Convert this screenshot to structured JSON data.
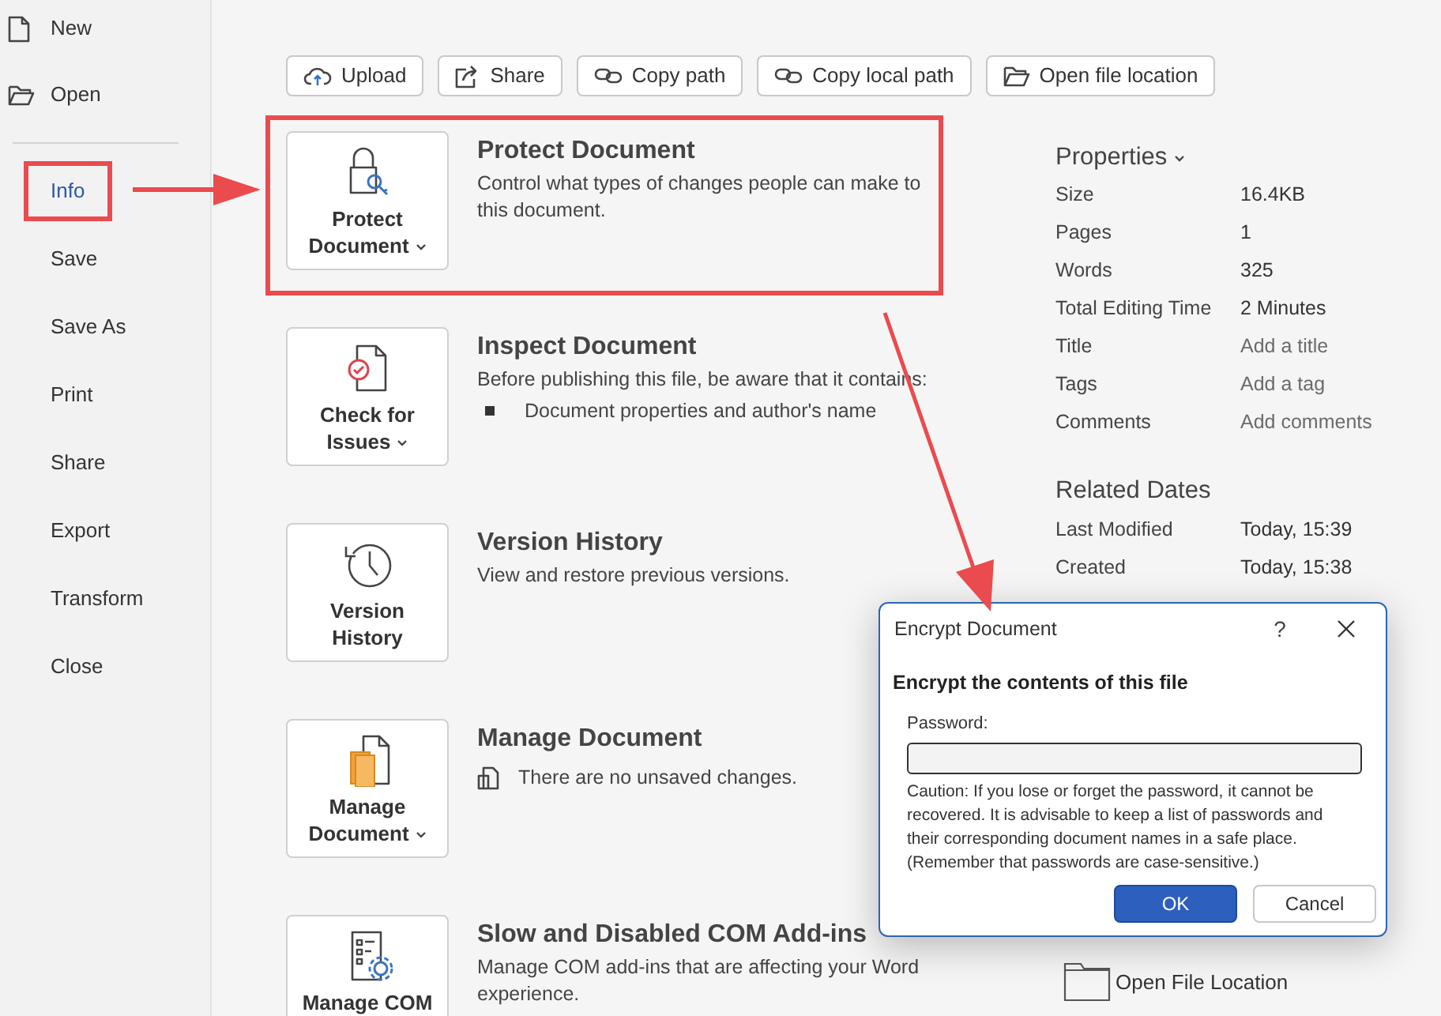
{
  "sidebar": {
    "top_items": [
      {
        "label": "New"
      },
      {
        "label": "Open"
      }
    ],
    "items": [
      {
        "label": "Info",
        "selected": true,
        "highlighted": true
      },
      {
        "label": "Save",
        "selected": false,
        "highlighted": false
      },
      {
        "label": "Save As",
        "selected": false,
        "highlighted": false
      },
      {
        "label": "Print",
        "selected": false,
        "highlighted": false
      },
      {
        "label": "Share",
        "selected": false,
        "highlighted": false
      },
      {
        "label": "Export",
        "selected": false,
        "highlighted": false
      },
      {
        "label": "Transform",
        "selected": false,
        "highlighted": false
      },
      {
        "label": "Close",
        "selected": false,
        "highlighted": false
      }
    ]
  },
  "toolbar": [
    "Upload",
    "Share",
    "Copy path",
    "Copy local path",
    "Open file location"
  ],
  "sections": [
    {
      "button_label": "Protect Document",
      "has_dropdown": true,
      "highlighted": true,
      "title": "Protect Document",
      "description": "Control what types of changes people can make to this document."
    },
    {
      "button_label": "Check for Issues",
      "has_dropdown": true,
      "highlighted": false,
      "title": "Inspect Document",
      "description": "Before publishing this file, be aware that it contains:",
      "bullets": [
        "Document properties and author's name"
      ]
    },
    {
      "button_label": "Version History",
      "has_dropdown": false,
      "highlighted": false,
      "title": "Version History",
      "description": "View and restore previous versions."
    },
    {
      "button_label": "Manage Document",
      "has_dropdown": true,
      "highlighted": false,
      "title": "Manage Document",
      "note": "There are no unsaved changes."
    },
    {
      "button_label": "Manage COM",
      "has_dropdown": false,
      "highlighted": false,
      "title": "Slow and Disabled COM Add-ins",
      "description": "Manage COM add-ins that are affecting your Word experience."
    }
  ],
  "properties": {
    "heading": "Properties",
    "rows": [
      {
        "label": "Size",
        "value": "16.4KB",
        "editable": false
      },
      {
        "label": "Pages",
        "value": "1",
        "editable": false
      },
      {
        "label": "Words",
        "value": "325",
        "editable": false
      },
      {
        "label": "Total Editing Time",
        "value": "2 Minutes",
        "editable": false
      },
      {
        "label": "Title",
        "placeholder": "Add a title",
        "editable": true
      },
      {
        "label": "Tags",
        "placeholder": "Add a tag",
        "editable": true
      },
      {
        "label": "Comments",
        "placeholder": "Add comments",
        "editable": true
      }
    ]
  },
  "related_dates": {
    "heading": "Related Dates",
    "rows": [
      {
        "label": "Last Modified",
        "value": "Today, 15:39"
      },
      {
        "label": "Created",
        "value": "Today, 15:38"
      }
    ]
  },
  "related_documents": {
    "link": "Open File Location"
  },
  "dialog": {
    "title": "Encrypt Document",
    "help": "?",
    "heading": "Encrypt the contents of this file",
    "field_label": "Password:",
    "caution": "Caution: If you lose or forget the password, it cannot be recovered. It is advisable to keep a list of passwords and their corresponding document names in a safe place. (Remember that passwords are case-sensitive.)",
    "buttons": [
      {
        "label": "OK",
        "kind": "primary"
      },
      {
        "label": "Cancel",
        "kind": "secondary"
      }
    ]
  }
}
